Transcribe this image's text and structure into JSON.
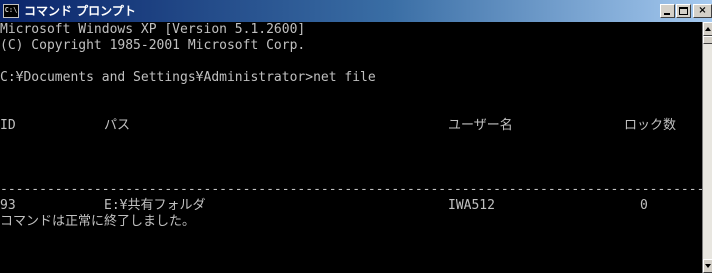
{
  "window": {
    "title": "コマンド プロンプト",
    "icon_label": "C:\\",
    "icon": "console-icon",
    "buttons": {
      "minimize_icon": "minimize-icon",
      "maximize_icon": "maximize-icon",
      "close_label": "×"
    }
  },
  "console": {
    "header_lines": [
      "Microsoft Windows XP [Version 5.1.2600]",
      "(C) Copyright 1985-2001 Microsoft Corp."
    ],
    "prompt": "C:¥Documents and Settings¥Administrator>net file",
    "table": {
      "columns": [
        "ID",
        "パス",
        "ユーザー名",
        "ロック数"
      ],
      "separator": "-------------------------------------------------------------------------------------------",
      "rows": [
        {
          "id": "93",
          "path": "E:¥共有フォルダ",
          "user": "IWA512",
          "locks": "0"
        }
      ]
    },
    "completion_message": "コマンドは正常に終了しました。"
  },
  "colors": {
    "console_bg": "#000000",
    "console_text": "#c0c0c0",
    "titlebar_start": "#0a246a",
    "titlebar_end": "#a6caf0"
  }
}
